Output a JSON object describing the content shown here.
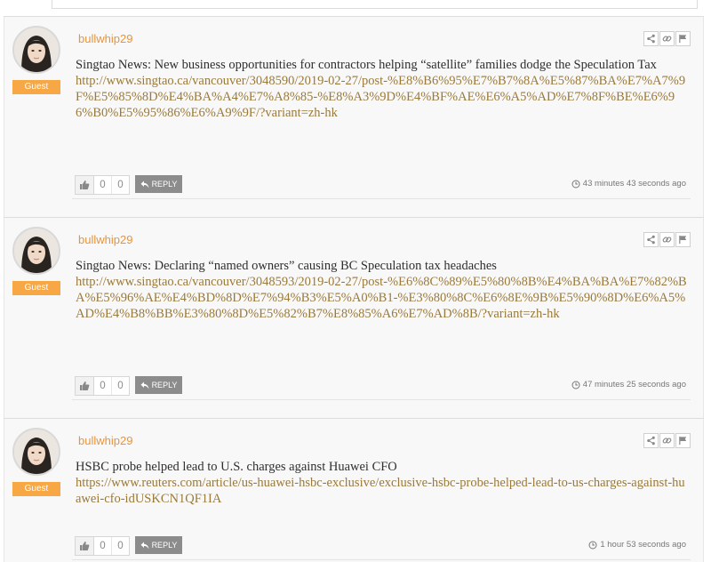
{
  "comments": [
    {
      "author": "bullwhip29",
      "badge": "Guest",
      "title": "Singtao News: New business opportunities for contractors helping “satellite” families dodge the Speculation Tax",
      "link": "http://www.singtao.ca/vancouver/3048590/2019-02-27/post-%E8%B6%95%E7%B7%8A%E5%87%BA%E7%A7%9F%E5%85%8D%E4%BA%A4%E7%A8%85-%E8%A3%9D%E4%BF%AE%E6%A5%AD%E7%8F%BE%E6%96%B0%E5%95%86%E6%A9%9F/?variant=zh-hk",
      "likes": "0",
      "dislikes": "0",
      "reply_label": "REPLY",
      "time": "43 minutes 43 seconds ago"
    },
    {
      "author": "bullwhip29",
      "badge": "Guest",
      "title": "Singtao News: Declaring “named owners” causing BC Speculation tax headaches",
      "link": "http://www.singtao.ca/vancouver/3048593/2019-02-27/post-%E6%8C%89%E5%80%8B%E4%BA%BA%E7%82%BA%E5%96%AE%E4%BD%8D%E7%94%B3%E5%A0%B1-%E3%80%8C%E6%8E%9B%E5%90%8D%E6%A5%AD%E4%B8%BB%E3%80%8D%E5%82%B7%E8%85%A6%E7%AD%8B/?variant=zh-hk",
      "likes": "0",
      "dislikes": "0",
      "reply_label": "REPLY",
      "time": "47 minutes 25 seconds ago"
    },
    {
      "author": "bullwhip29",
      "badge": "Guest",
      "title": "HSBC probe helped lead to U.S. charges against Huawei CFO",
      "link": "https://www.reuters.com/article/us-huawei-hsbc-exclusive/exclusive-hsbc-probe-helped-lead-to-us-charges-against-huawei-cfo-idUSKCN1QF1IA",
      "likes": "0",
      "dislikes": "0",
      "reply_label": "REPLY",
      "time": "1 hour 53 seconds ago"
    }
  ],
  "icons": {
    "share": "share-icon",
    "permalink": "link-icon",
    "flag": "flag-icon",
    "like": "thumbs-up-icon",
    "reply": "reply-arrow-icon",
    "time": "clock-icon"
  },
  "colors": {
    "author": "#e8953a",
    "badge": "#f7a744",
    "link": "#9a7a3a",
    "reply_button": "#8c8c8c"
  }
}
